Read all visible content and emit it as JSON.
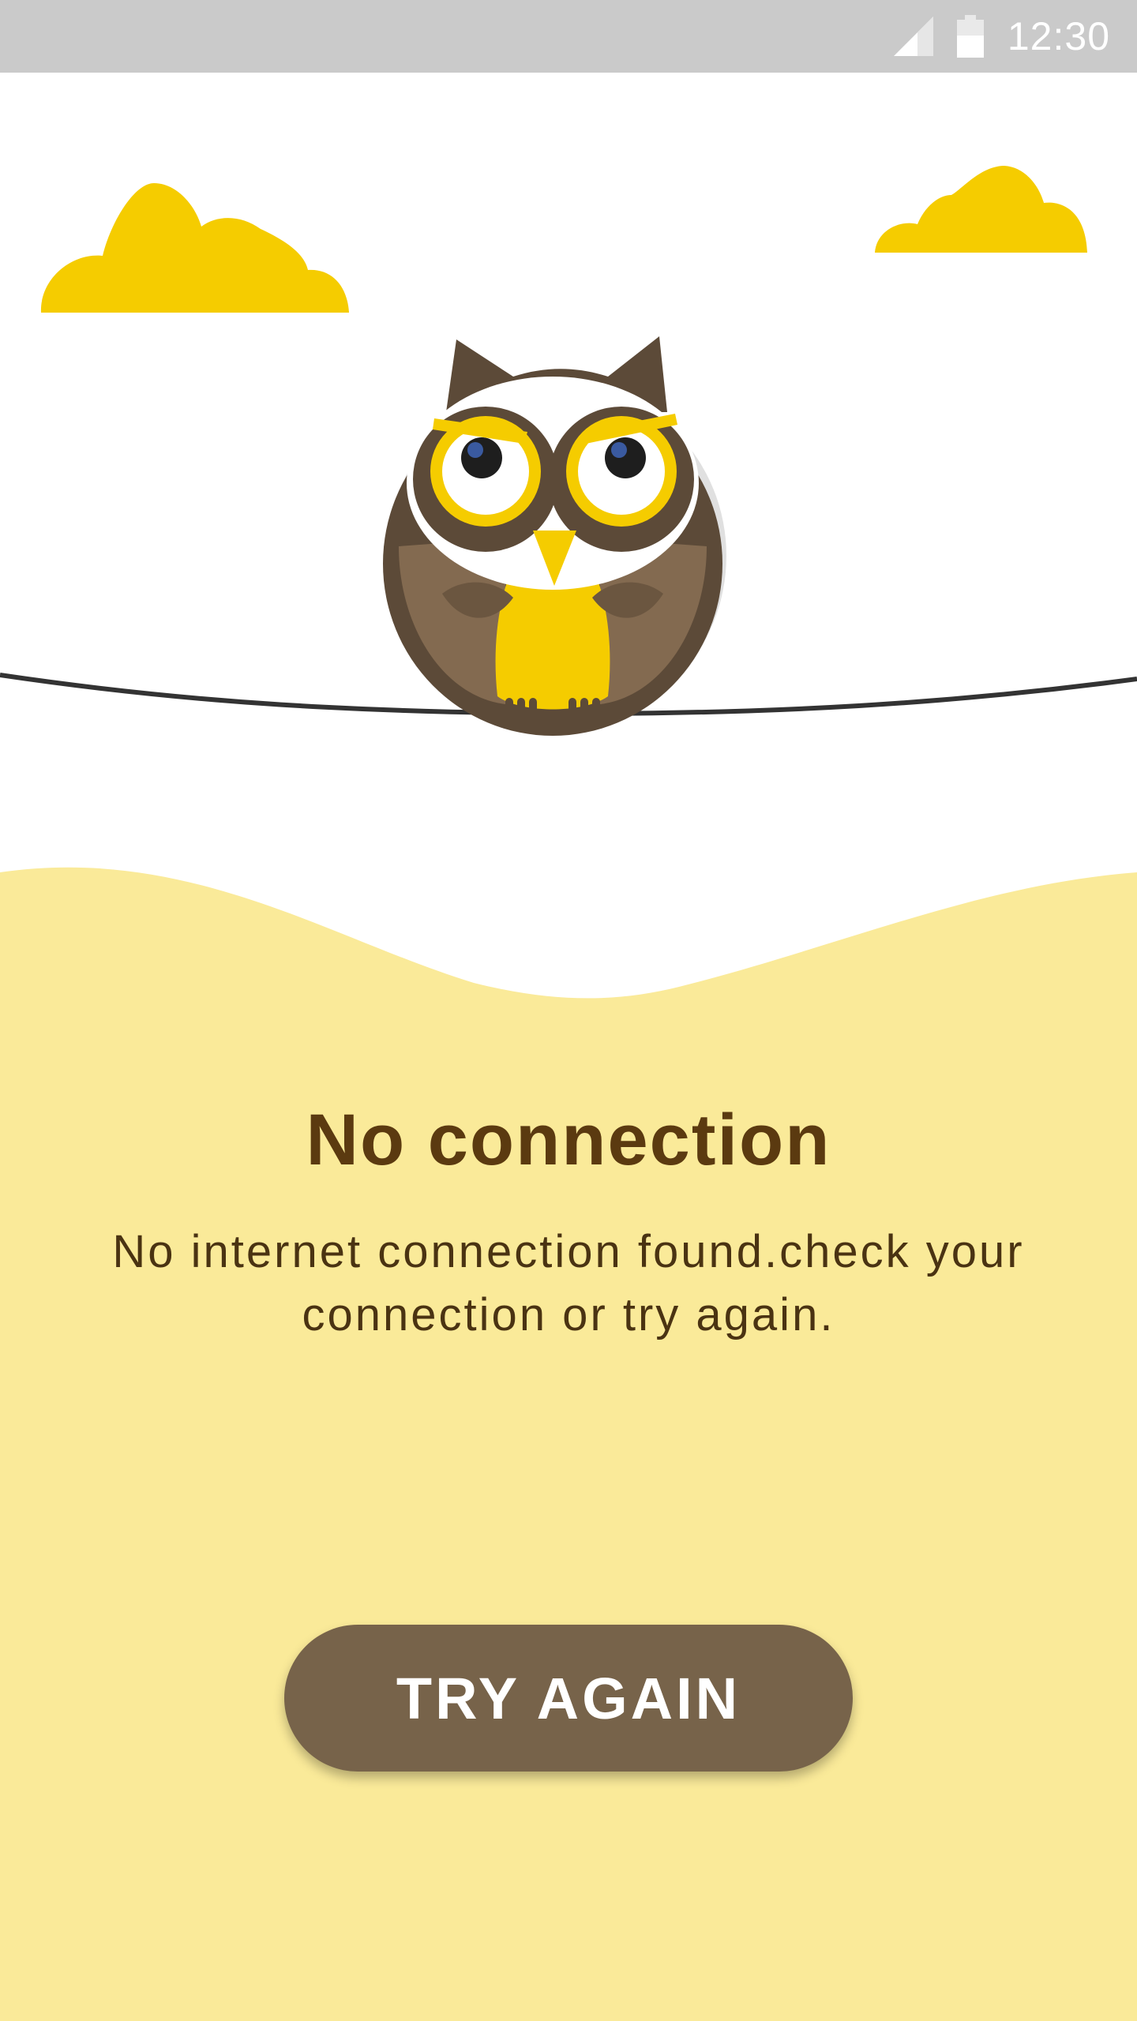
{
  "status_bar": {
    "time": "12:30",
    "icons": [
      "signal-icon",
      "battery-icon"
    ]
  },
  "illustration": {
    "subject": "owl-on-wire",
    "icons": [
      "cloud-icon",
      "cloud-icon",
      "owl-icon"
    ]
  },
  "content": {
    "title": "No connection",
    "message": "No internet connection found.check your connection or try again."
  },
  "actions": {
    "try_again_label": "TRY AGAIN"
  },
  "colors": {
    "status_bar": "#cacaca",
    "cloud": "#f5cc00",
    "panel": "#faea99",
    "title": "#5b3a10",
    "button": "#77634a",
    "owl_brown_dark": "#5c4a38",
    "owl_brown_light": "#836a50",
    "owl_yellow": "#f5cc00"
  }
}
